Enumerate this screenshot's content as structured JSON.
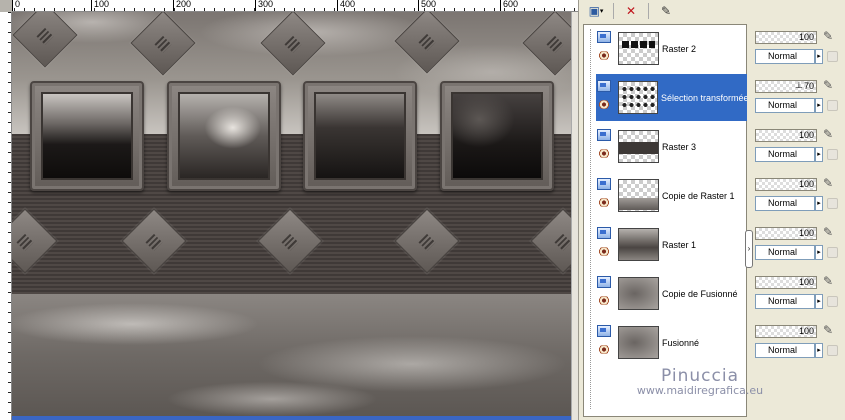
{
  "ruler": {
    "ticks": [
      "0",
      "100",
      "200",
      "300",
      "400",
      "500",
      "600"
    ]
  },
  "layers": [
    {
      "name": "Raster 2",
      "opacity": "100",
      "blend": "Normal",
      "selected": false
    },
    {
      "name": "Sélection transformée",
      "opacity": "70",
      "blend": "Normal",
      "selected": true
    },
    {
      "name": "Raster 3",
      "opacity": "100",
      "blend": "Normal",
      "selected": false
    },
    {
      "name": "Copie de Raster 1",
      "opacity": "100",
      "blend": "Normal",
      "selected": false
    },
    {
      "name": "Raster 1",
      "opacity": "100",
      "blend": "Normal",
      "selected": false
    },
    {
      "name": "Copie de Fusionné",
      "opacity": "100",
      "blend": "Normal",
      "selected": false
    },
    {
      "name": "Fusionné",
      "opacity": "100",
      "blend": "Normal",
      "selected": false
    }
  ],
  "watermark": {
    "title": "Pinuccia",
    "url": "www.maidiregrafica.eu"
  },
  "colors": {
    "selection": "#316ac5",
    "palette_bg": "#ece9d8"
  }
}
